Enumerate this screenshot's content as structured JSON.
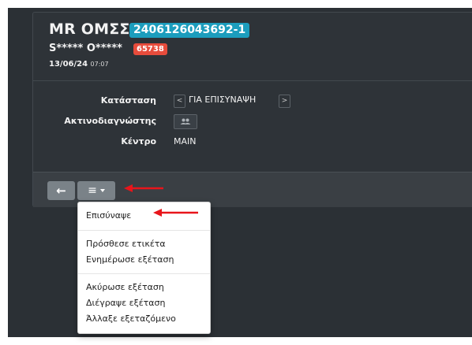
{
  "header": {
    "title": "MR ΟΜΣΣ",
    "accession": "2406126043692-1",
    "patient_name": "S***** O*****",
    "patient_id": "65738",
    "date": "13/06/24",
    "time": "07:07"
  },
  "details": {
    "status_label": "Κατάσταση",
    "status_value": "ΓΙΑ ΕΠΙΣΥΝΑΨΗ",
    "radiologist_label": "Ακτινοδιαγνώστης",
    "center_label": "Κέντρο",
    "center_value": "MAIN"
  },
  "footer": {
    "back_glyph": "←",
    "menu_glyph": "≡"
  },
  "menu": {
    "items": [
      "Επισύναψε",
      "Πρόσθεσε ετικέτα",
      "Ενημέρωσε εξέταση",
      "Ακύρωσε εξέταση",
      "Διέγραψε εξέταση",
      "Άλλαξε εξεταζόμενο"
    ]
  },
  "colors": {
    "accession_badge": "#1c9dbd",
    "id_badge": "#e74c3c",
    "annotation_arrow": "#e8151b",
    "panel_bg": "#2e3338",
    "button_bg": "#7a8288"
  }
}
